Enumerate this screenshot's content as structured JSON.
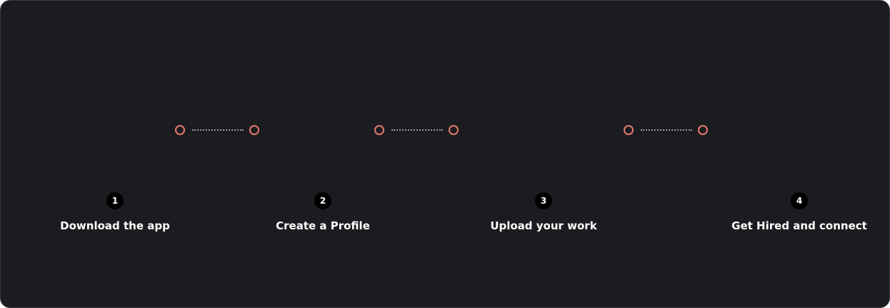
{
  "accent_color": "#e57a6e",
  "background_color": "#1b1c20",
  "steps": [
    {
      "number": "1",
      "label": "Download the app"
    },
    {
      "number": "2",
      "label": "Create a Profile"
    },
    {
      "number": "3",
      "label": "Upload your work"
    },
    {
      "number": "4",
      "label": "Get Hired and connect"
    }
  ]
}
